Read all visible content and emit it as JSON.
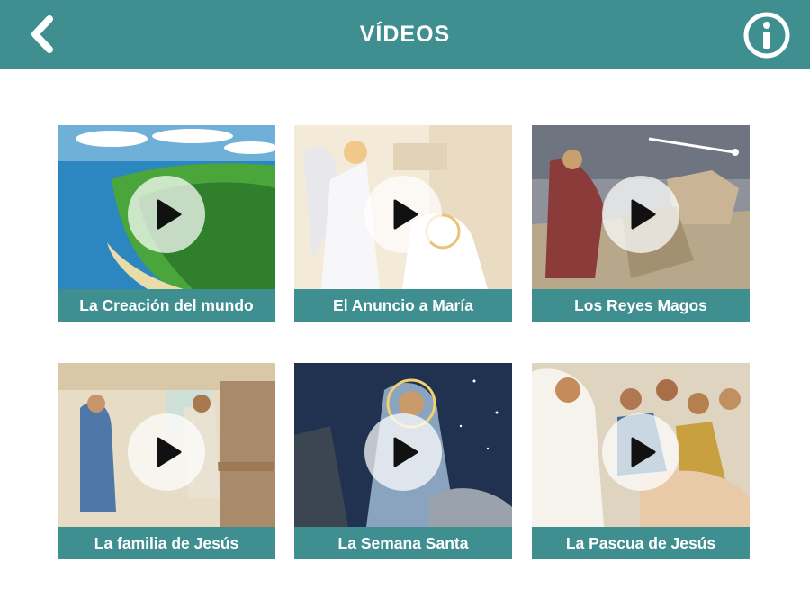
{
  "header": {
    "title": "VÍDEOS",
    "back_icon": "chevron-left-icon",
    "info_icon": "info-icon"
  },
  "colors": {
    "accent": "#3f8f91",
    "header_text": "#ffffff",
    "caption_text": "#ffffff"
  },
  "videos": [
    {
      "title": "La Creación del mundo"
    },
    {
      "title": "El Anuncio a María"
    },
    {
      "title": "Los Reyes Magos"
    },
    {
      "title": "La familia de Jesús"
    },
    {
      "title": "La Semana Santa"
    },
    {
      "title": "La Pascua de Jesús"
    }
  ]
}
